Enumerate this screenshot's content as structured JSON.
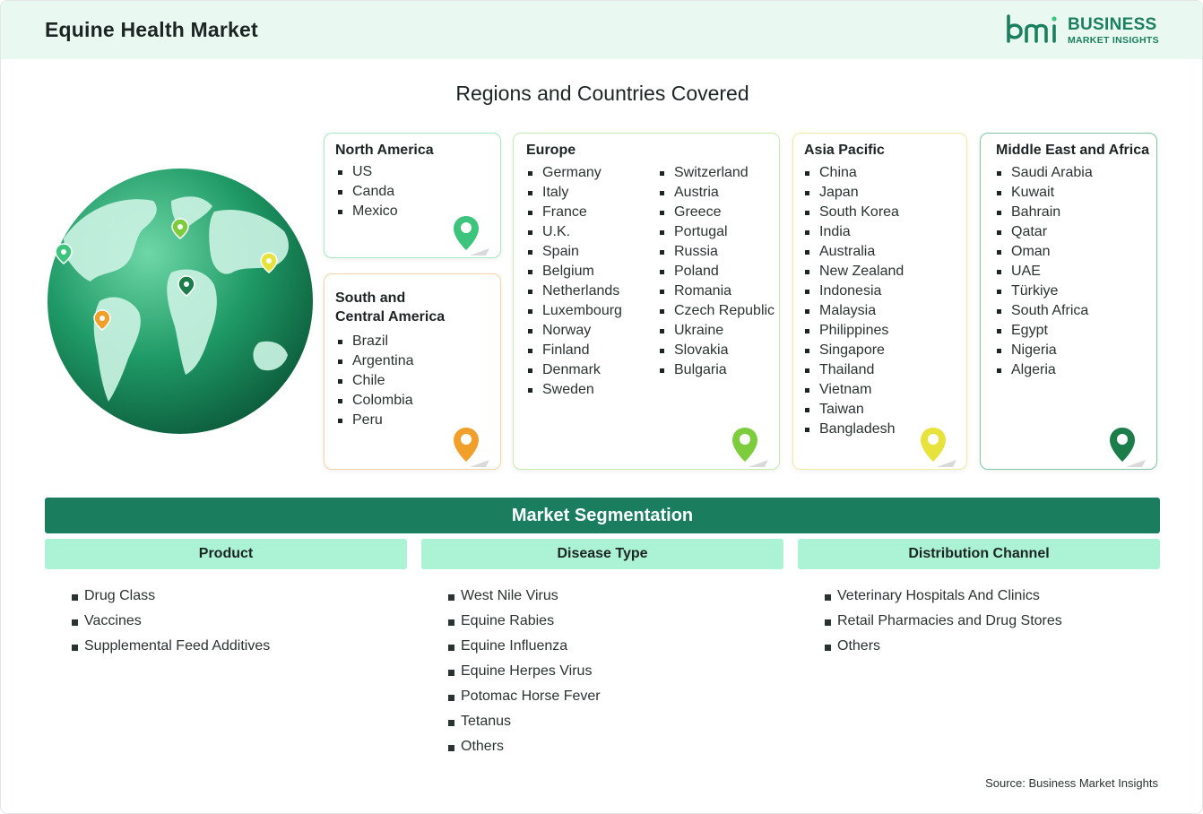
{
  "header": {
    "title": "Equine Health Market"
  },
  "logo": {
    "word1": "BUSINESS",
    "word2": "MARKET INSIGHTS"
  },
  "section_title": "Regions and Countries Covered",
  "regions": {
    "north_america": {
      "title": "North America",
      "countries": [
        "US",
        "Canda",
        "Mexico"
      ],
      "color": "#3cc47c"
    },
    "south_america": {
      "title_line1": "South and",
      "title_line2": "Central America",
      "countries": [
        "Brazil",
        "Argentina",
        "Chile",
        "Colombia",
        "Peru"
      ],
      "color": "#f0a02a"
    },
    "europe": {
      "title": "Europe",
      "countries_col1": [
        "Germany",
        "Italy",
        "France",
        "U.K.",
        "Spain",
        "Belgium",
        "Netherlands",
        "Luxembourg",
        "Norway",
        "Finland",
        "Denmark",
        "Sweden"
      ],
      "countries_col2": [
        "Switzerland",
        "Austria",
        "Greece",
        "Portugal",
        "Russia",
        "Poland",
        "Romania",
        "Czech Republic",
        "Ukraine",
        "Slovakia",
        "Bulgaria"
      ],
      "color": "#7ccc3c"
    },
    "asia_pacific": {
      "title": "Asia Pacific",
      "countries": [
        "China",
        "Japan",
        "South Korea",
        "India",
        "Australia",
        "New Zealand",
        "Indonesia",
        "Malaysia",
        "Philippines",
        "Singapore",
        "Thailand",
        "Vietnam",
        "Taiwan",
        "Bangladesh"
      ],
      "color": "#e8e33c"
    },
    "mea": {
      "title": "Middle East and Africa",
      "countries": [
        "Saudi Arabia",
        "Kuwait",
        "Bahrain",
        "Qatar",
        "Oman",
        "UAE",
        "Türkiye",
        "South Africa",
        "Egypt",
        "Nigeria",
        "Algeria"
      ],
      "color": "#1a7d4a"
    }
  },
  "segmentation": {
    "title": "Market Segmentation",
    "columns": [
      {
        "heading": "Product",
        "items": [
          "Drug Class",
          "Vaccines",
          "Supplemental Feed Additives"
        ]
      },
      {
        "heading": "Disease Type",
        "items": [
          "West Nile Virus",
          "Equine Rabies",
          "Equine Influenza",
          "Equine Herpes Virus",
          "Potomac Horse Fever",
          "Tetanus",
          "Others"
        ]
      },
      {
        "heading": "Distribution Channel",
        "items": [
          "Veterinary Hospitals And Clinics",
          "Retail Pharmacies and Drug Stores",
          "Others"
        ]
      }
    ]
  },
  "source": "Source: Business Market Insights",
  "colors": {
    "brand": "#1a7d5d",
    "header_bg": "#e9f8f1",
    "seg_head_bg": "#abf3d4"
  },
  "icons": {
    "globe": "globe-icon",
    "pin": "map-pin-icon",
    "logo": "bmi-logo-icon"
  }
}
